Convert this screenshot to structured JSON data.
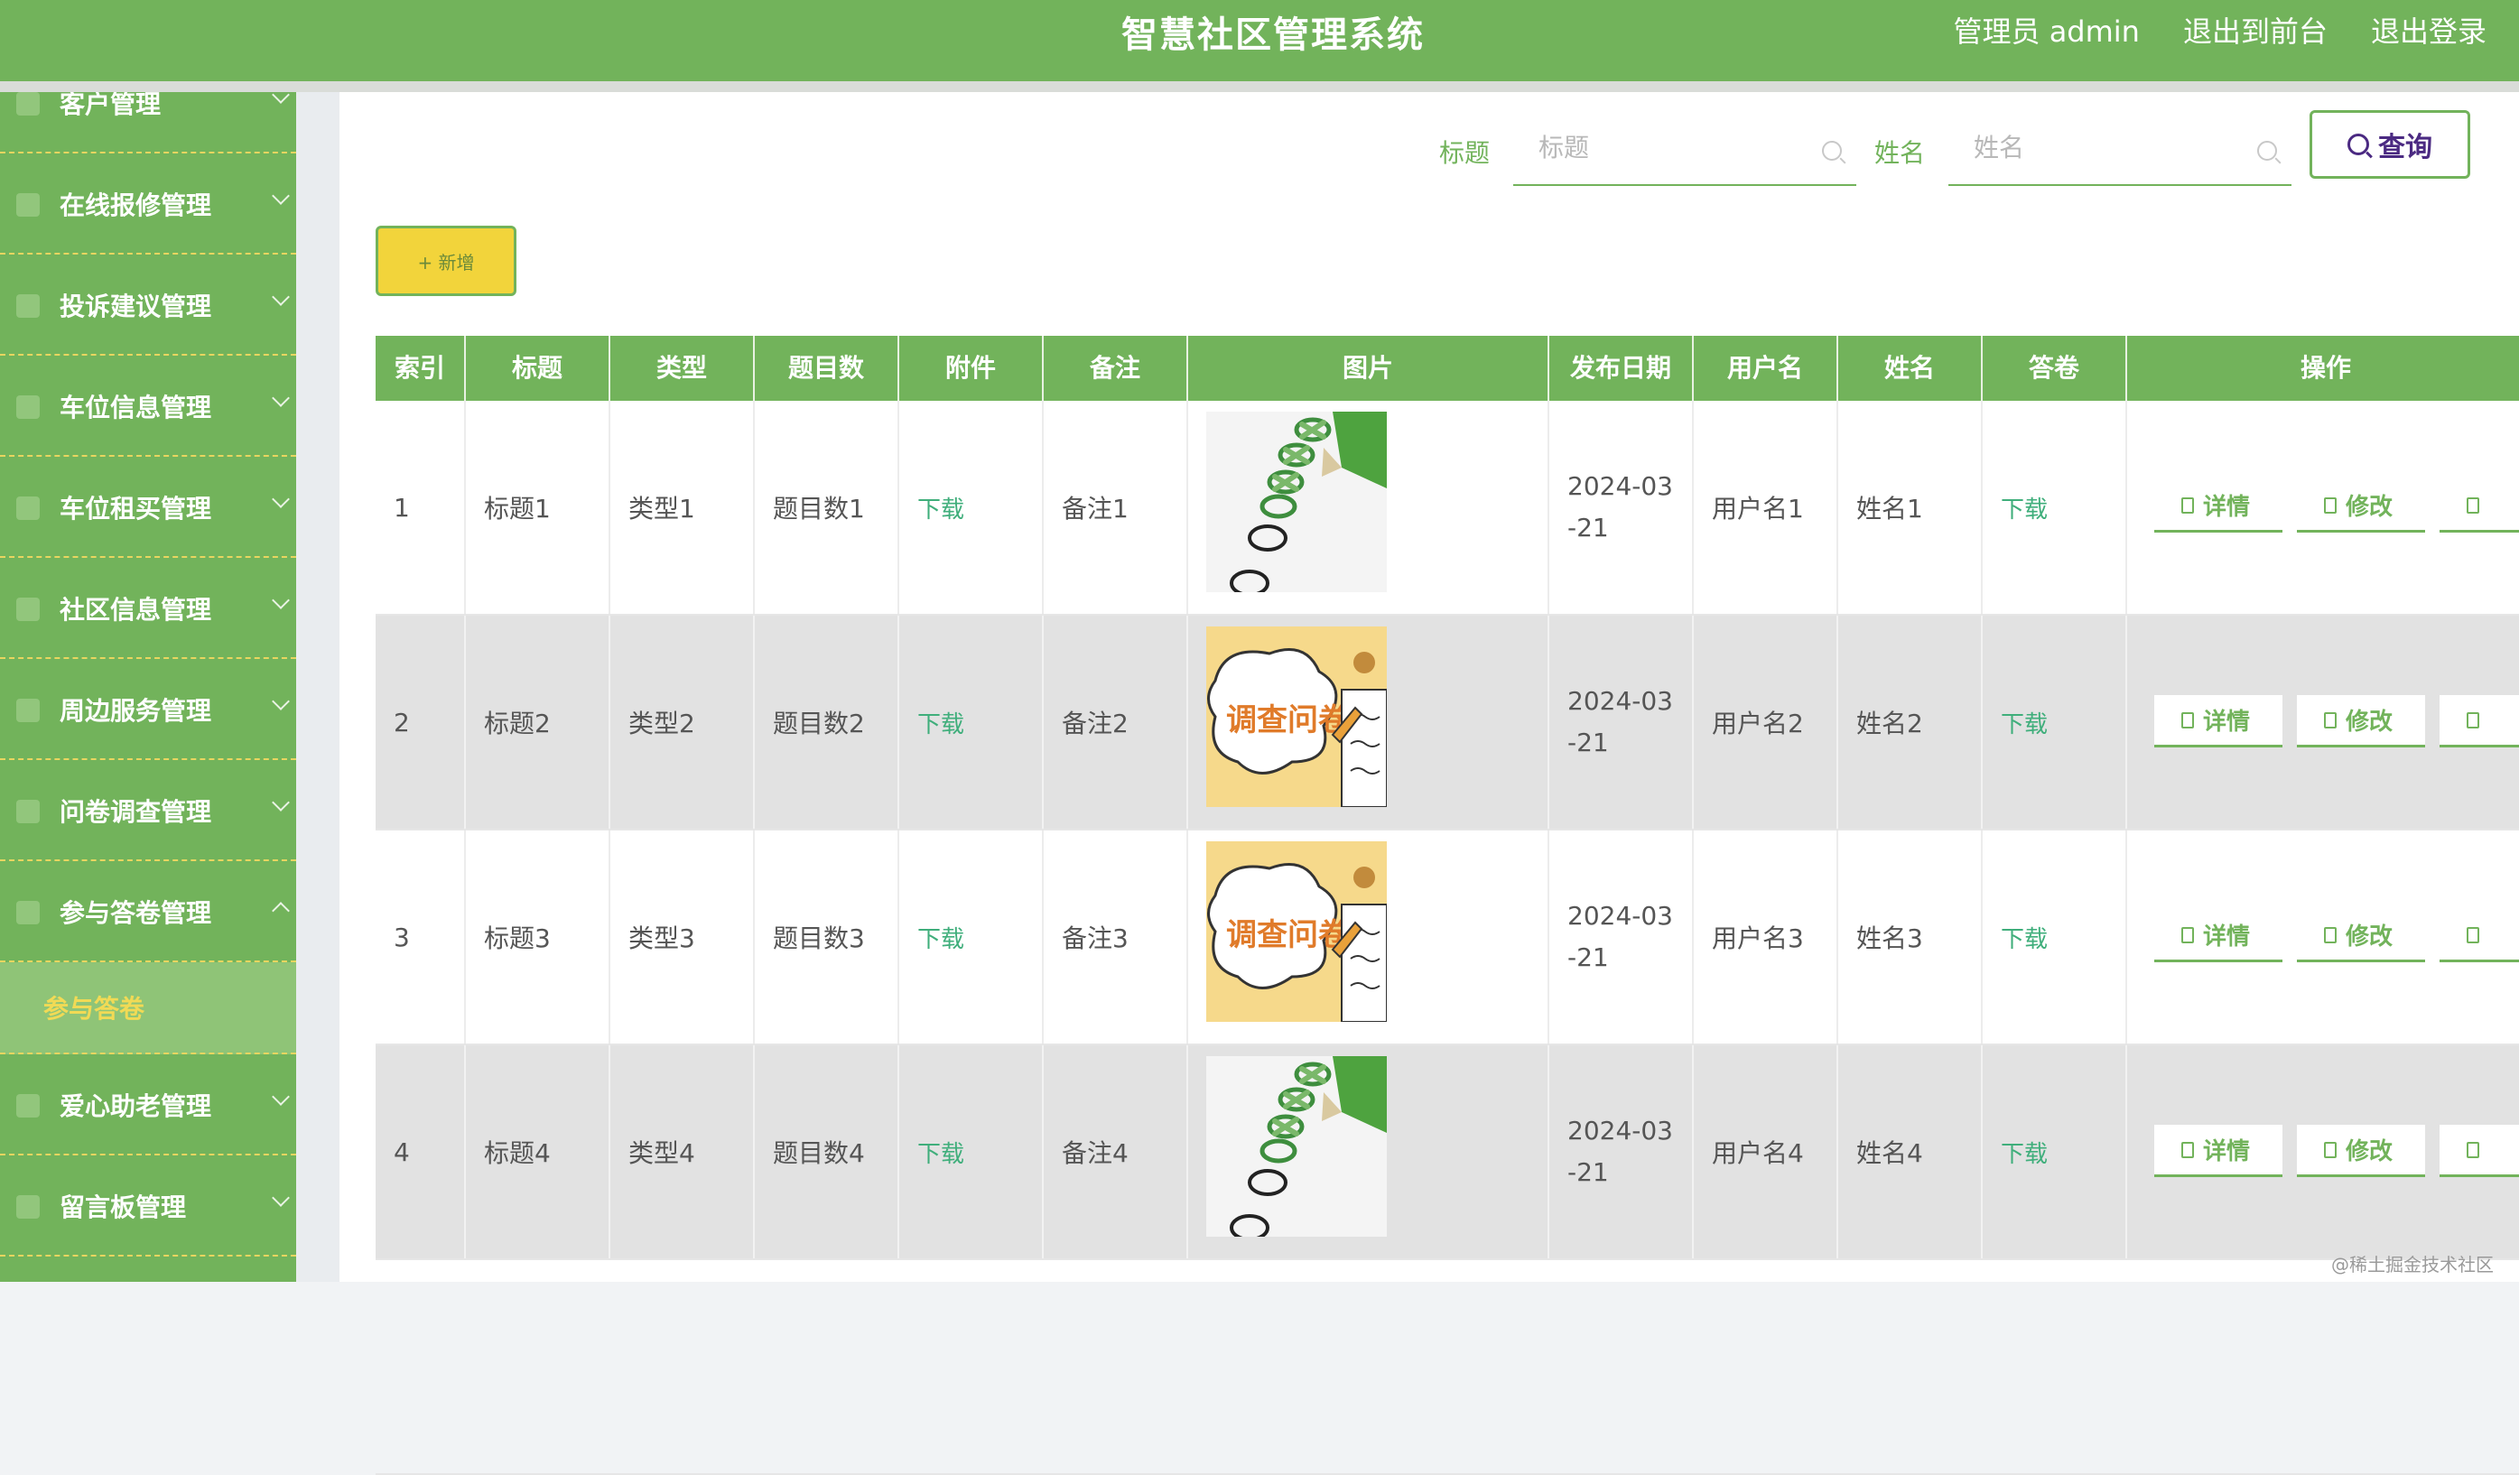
{
  "header": {
    "title": "智慧社区管理系统",
    "admin": "管理员 admin",
    "exit_front": "退出到前台",
    "logout": "退出登录"
  },
  "sidebar": {
    "items": [
      {
        "label": "客户管理",
        "icon": "user-icon"
      },
      {
        "label": "在线报修管理",
        "icon": "wrench-icon"
      },
      {
        "label": "投诉建议管理",
        "icon": "message-icon"
      },
      {
        "label": "车位信息管理",
        "icon": "parking-icon"
      },
      {
        "label": "车位租买管理",
        "icon": "car-icon"
      },
      {
        "label": "社区信息管理",
        "icon": "building-icon"
      },
      {
        "label": "周边服务管理",
        "icon": "service-icon"
      },
      {
        "label": "问卷调查管理",
        "icon": "survey-icon"
      },
      {
        "label": "参与答卷管理",
        "icon": "answer-icon"
      },
      {
        "label": "爱心助老管理",
        "icon": "heart-icon"
      },
      {
        "label": "留言板管理",
        "icon": "board-icon"
      }
    ],
    "active_sub": "参与答卷"
  },
  "search": {
    "title_label": "标题",
    "title_placeholder": "标题",
    "name_label": "姓名",
    "name_placeholder": "姓名",
    "query_label": "查询"
  },
  "toolbar": {
    "add_label": "+ 新增"
  },
  "table": {
    "headers": [
      "索引",
      "标题",
      "类型",
      "题目数",
      "附件",
      "备注",
      "图片",
      "发布日期",
      "用户名",
      "姓名",
      "答卷",
      "操作"
    ],
    "rows": [
      {
        "index": "1",
        "title": "标题1",
        "type": "类型1",
        "count": "题目数1",
        "attach": "下载",
        "note": "备注1",
        "date": "2024-03\n-21",
        "username": "用户名1",
        "name": "姓名1",
        "answer": "下载",
        "pic": "checklist-image"
      },
      {
        "index": "2",
        "title": "标题2",
        "type": "类型2",
        "count": "题目数2",
        "attach": "下载",
        "note": "备注2",
        "date": "2024-03\n-21",
        "username": "用户名2",
        "name": "姓名2",
        "answer": "下载",
        "pic": "survey-image"
      },
      {
        "index": "3",
        "title": "标题3",
        "type": "类型3",
        "count": "题目数3",
        "attach": "下载",
        "note": "备注3",
        "date": "2024-03\n-21",
        "username": "用户名3",
        "name": "姓名3",
        "answer": "下载",
        "pic": "survey-image"
      },
      {
        "index": "4",
        "title": "标题4",
        "type": "类型4",
        "count": "题目数4",
        "attach": "下载",
        "note": "备注4",
        "date": "2024-03\n-21",
        "username": "用户名4",
        "name": "姓名4",
        "answer": "下载",
        "pic": "checklist-image"
      }
    ],
    "detail_label": "详情",
    "edit_label": "修改"
  },
  "survey_image_text": "调查问卷",
  "watermark": "@稀土掘金技术社区",
  "colors": {
    "primary": "#72b35b",
    "accent": "#f2d43b",
    "link": "#3fae7b",
    "query_text": "#4b2a82"
  }
}
